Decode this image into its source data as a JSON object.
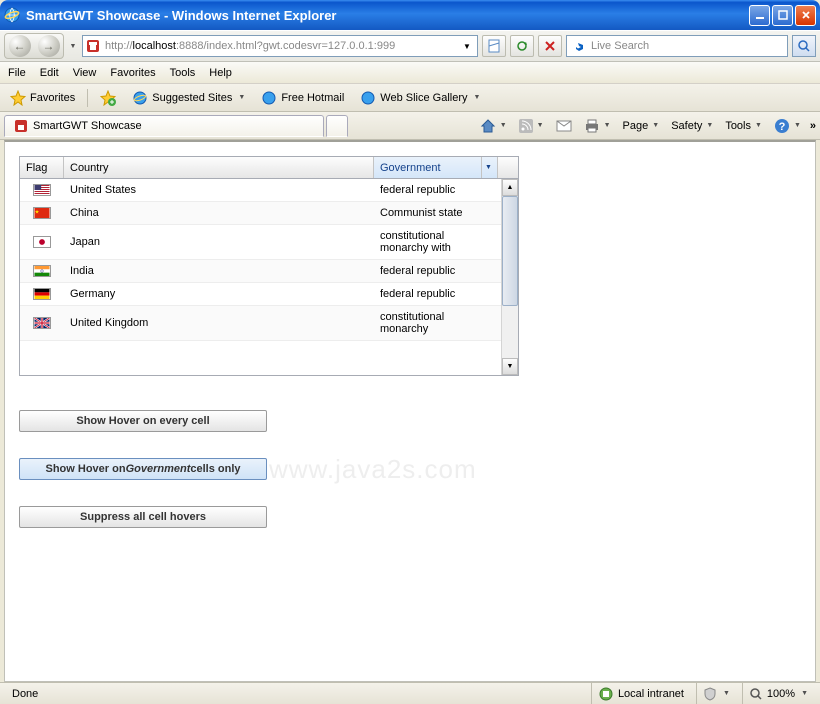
{
  "window": {
    "title": "SmartGWT Showcase - Windows Internet Explorer"
  },
  "nav": {
    "url_prefix": "http://",
    "url_host": "localhost",
    "url_rest": ":8888/index.html?gwt.codesvr=127.0.0.1:999",
    "search_placeholder": "Live Search"
  },
  "menu": {
    "file": "File",
    "edit": "Edit",
    "view": "View",
    "favorites": "Favorites",
    "tools": "Tools",
    "help": "Help"
  },
  "favbar": {
    "favorites": "Favorites",
    "suggested": "Suggested Sites",
    "hotmail": "Free Hotmail",
    "webslice": "Web Slice Gallery"
  },
  "tab": {
    "title": "SmartGWT Showcase"
  },
  "cmdbar": {
    "page": "Page",
    "safety": "Safety",
    "tools": "Tools"
  },
  "grid": {
    "headers": {
      "flag": "Flag",
      "country": "Country",
      "gov": "Government"
    },
    "rows": [
      {
        "country": "United States",
        "gov": "federal republic",
        "flag": "us"
      },
      {
        "country": "China",
        "gov": "Communist state",
        "flag": "cn"
      },
      {
        "country": "Japan",
        "gov": "constitutional monarchy with",
        "flag": "jp"
      },
      {
        "country": "India",
        "gov": "federal republic",
        "flag": "in"
      },
      {
        "country": "Germany",
        "gov": "federal republic",
        "flag": "de"
      },
      {
        "country": "United Kingdom",
        "gov": "constitutional monarchy",
        "flag": "gb"
      }
    ]
  },
  "buttons": {
    "b1": "Show Hover on every cell",
    "b2_pre": "Show Hover on ",
    "b2_em": "Government",
    "b2_post": " cells only",
    "b3": "Suppress all cell hovers"
  },
  "status": {
    "done": "Done",
    "zone": "Local intranet",
    "zoom": "100%"
  },
  "watermark": "www.java2s.com"
}
